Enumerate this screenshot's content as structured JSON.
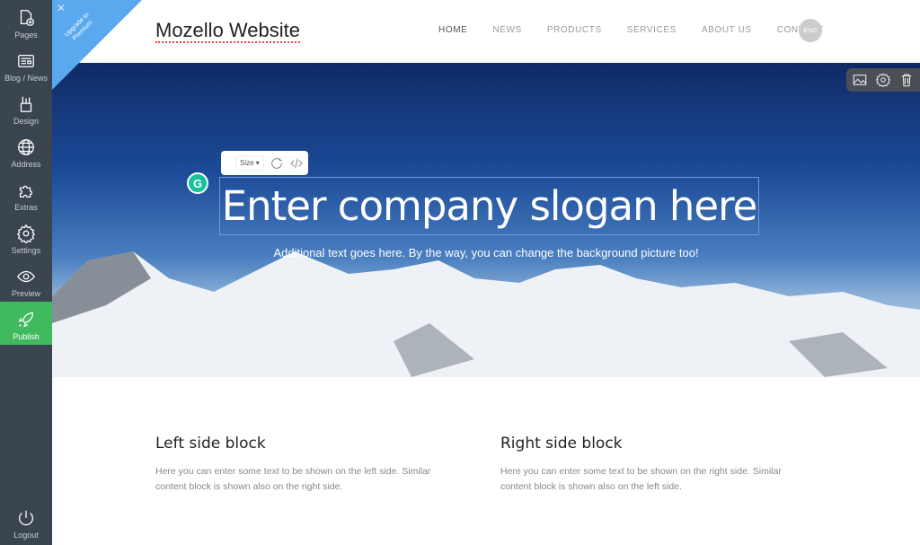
{
  "sidebar": {
    "items": [
      {
        "label": "Pages",
        "icon": "page-add-icon"
      },
      {
        "label": "Blog / News",
        "icon": "newspaper-icon"
      },
      {
        "label": "Design",
        "icon": "pencil-cup-icon"
      },
      {
        "label": "Address",
        "icon": "globe-icon"
      },
      {
        "label": "Extras",
        "icon": "puzzle-icon"
      },
      {
        "label": "Settings",
        "icon": "gear-icon"
      },
      {
        "label": "Preview",
        "icon": "eye-icon"
      },
      {
        "label": "Publish",
        "icon": "rocket-icon"
      }
    ],
    "logout": "Logout"
  },
  "ribbon": {
    "text": "Upgrade to Premium"
  },
  "header": {
    "brand": "Mozello Website",
    "nav": [
      "HOME",
      "NEWS",
      "PRODUCTS",
      "SERVICES",
      "ABOUT US",
      "CONTACT"
    ],
    "lang": "ENG"
  },
  "hero": {
    "slogan": "Enter company slogan here",
    "subtitle": "Additional text goes here. By the way, you can change the background picture too!",
    "toolbar": {
      "size": "Size"
    }
  },
  "blocks": [
    {
      "title": "Left side block",
      "text": "Here you can enter some text to be shown on the left side. Similar content block is shown also on the right side."
    },
    {
      "title": "Right side block",
      "text": "Here you can enter some text to be shown on the right side. Similar content block is shown also on the left side."
    }
  ],
  "colors": {
    "sidebar": "#3b4550",
    "publish": "#41b95f",
    "ribbon": "#5aa9ef"
  }
}
